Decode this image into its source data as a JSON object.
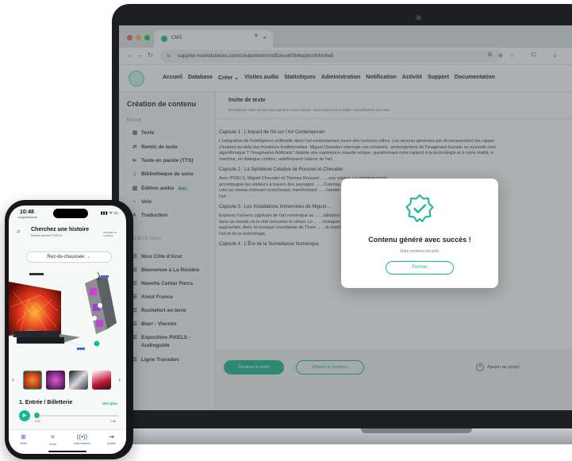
{
  "browser": {
    "tab_title": "CMS",
    "tab_close": "×",
    "new_tab": "+",
    "url": "supplier.rewindstories.com/create/text/cmd5zkoot05t4wpbctrhfm9w5",
    "nav_icons": [
      "←",
      "→",
      "↻"
    ],
    "url_icon": "⇆",
    "extension_icons": [
      "⧉",
      "⊕",
      "☆",
      "⧠",
      "⤓"
    ]
  },
  "topnav": {
    "items": [
      "Accueil",
      "Database",
      "Créer ⌄",
      "Visites audio",
      "Statistiques",
      "Administration",
      "Notification",
      "Activité",
      "Support",
      "Documentation"
    ]
  },
  "sidebar": {
    "title": "Création de contenu",
    "section_media": "MÉDIA",
    "items": [
      {
        "icon": "▤",
        "label": "Texte"
      },
      {
        "icon": "⇄",
        "label": "Remix de texte"
      },
      {
        "icon": "⊳",
        "label": "Texte en parole (TTS)"
      },
      {
        "icon": "♫",
        "label": "Bibliothèque de sons"
      },
      {
        "icon": "▥",
        "label": "Édition audio",
        "badge": "Beta"
      },
      {
        "icon": "◔",
        "label": "Voix"
      },
      {
        "icon": "A",
        "label": "Traduction"
      }
    ],
    "section_projects": "PROJETS (Qlik)",
    "projects": [
      {
        "icon": "☰",
        "label": "Nice Côte d'Azur"
      },
      {
        "icon": "☰",
        "label": "Bienvenue à La Rosière"
      },
      {
        "icon": "☰",
        "label": "Navette Center Parcs"
      },
      {
        "icon": "☰",
        "label": "Atout France"
      },
      {
        "icon": "☰",
        "label": "Rochefort en terre"
      },
      {
        "icon": "☰",
        "label": "Biarr - Vierzon"
      },
      {
        "icon": "☰",
        "label": "Exposition PIXELS -"
      },
      {
        "icon": "",
        "label": "Audioguide"
      },
      {
        "icon": "☰",
        "label": "Ligne Transdev"
      }
    ]
  },
  "header": {
    "title": "Invite de texte",
    "subtitle": "Remplissez cette section pour générer votre histoire. Vous pourrez la modifier manuellement plus tard."
  },
  "editor": {
    "blocks": [
      {
        "heading": "Capsule 1 : L'Impact de l'IA sur l'Art Contemporain",
        "lines": [
          "L'intégration de l'intelligence artificielle dans l'art contemporain ouvre des horizons infinis. Les œuvres générées par IA transcendent les capaci",
          "s'invitent au-delà des frontières traditionnelles. Miguel Chevalier interroge ces créations : prolongement de l'imaginaire humain ou nouvelle cont",
          "algorithmique ? \"Imaginaires Artificiels\" déploie une expérience visuelle unique, questionnant notre rapport à la technologie et à notre réalité, e",
          "machine, en dialogue continu, redéfinissent l'avenir de l'art."
        ]
      },
      {
        "heading": "Capsule 2 : La Symbiose Créative de Rousset et Chevalier",
        "lines": [
          "Avec PIXELS, Miguel Chevalier et Thomas Rousset ...                                                                    ...une unique. La musique envel",
          "accompagne les visiteurs à travers des paysages ...                                                                    ...Cosmiques. Ce mariage d'ima",
          "crée un réseau innovant enrichissant, transformant ...                                                                  ...tandier notre relation avec la",
          "l'art."
        ]
      },
      {
        "heading": "Capsule 3 : Les Installations Immersives de Miguel ...",
        "lines": [
          "Explorez l'univers captivant de l'art numérique av ...                                                                  ...tallations génératives et intera",
          "dans un monde où le réel rencontre le virtuel. Le ...                                                                  ...changent chaque visiteur en act",
          "augmentés. Avec la musique envoûtante de Thom ...                                                                      ...la machine, redéfinissant notre",
          "l'art et de la technologie."
        ]
      },
      {
        "heading": "Capsule 4 : L'Ère de la Surveillance Numérique",
        "lines": []
      }
    ]
  },
  "actions": {
    "generate": "Générer le texte",
    "clear": "Effacer le contenu",
    "add_project": "Ajouter au projet",
    "add_icon": "+"
  },
  "modal": {
    "title": "Contenu généré avec succès !",
    "subtitle": "Votre contenu est prêt.",
    "button": "Fermer"
  },
  "phone": {
    "time": "10:48",
    "status_sub": "◂ Appareil photo",
    "status_icons": "▮▮▮ ᯤ ▭",
    "search_icon": "⌕",
    "title": "Cherchez une histoire",
    "subtitle": "Balade secrets PIXELS",
    "lang": "CHOISIR LA LANGUE",
    "floor": "Rez-de-chaussée",
    "floor_chevron": "⌄",
    "prev": "‹",
    "next": "›",
    "track": "1. Entrée / Billetterie",
    "voir_plus": "Voir plus",
    "play_icon": "▶",
    "time_start": "0:03",
    "time_end": "1:48",
    "tabs": [
      {
        "icon": "⊞",
        "label": "Visite"
      },
      {
        "icon": "⌗",
        "label": "Scan"
      },
      {
        "icon": "((•))",
        "label": "Informations"
      },
      {
        "icon": "⇥",
        "label": "Quitter"
      }
    ]
  },
  "colors": {
    "accent": "#19b894",
    "overlay": "#46505066"
  }
}
